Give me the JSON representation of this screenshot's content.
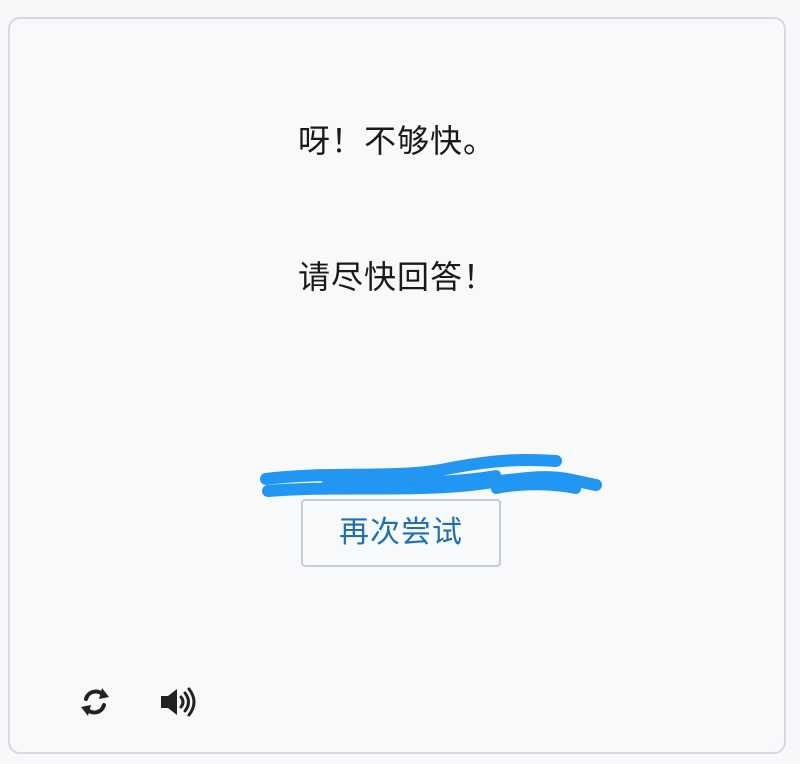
{
  "message": {
    "line1": "呀！不够快。",
    "line2": "请尽快回答！"
  },
  "actions": {
    "retry_label": "再次尝试"
  },
  "icons": {
    "refresh": "refresh-icon",
    "audio": "speaker-icon"
  },
  "colors": {
    "button_text": "#1f6fb3",
    "scribble": "#2196f3",
    "text": "#1a1a1a"
  }
}
